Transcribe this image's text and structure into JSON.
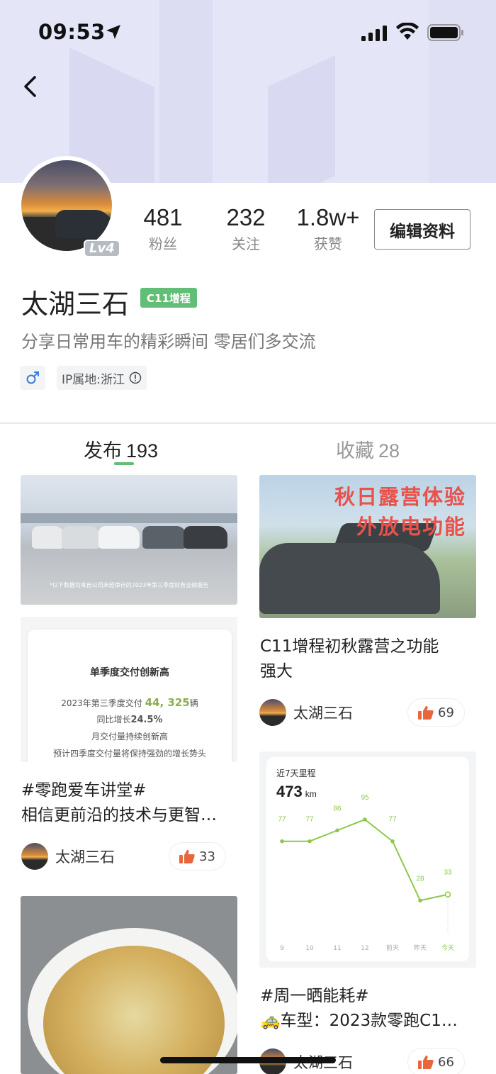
{
  "status_bar": {
    "time": "09:53"
  },
  "profile": {
    "level": "Lv4",
    "stats": [
      {
        "value": "481",
        "label": "粉丝"
      },
      {
        "value": "232",
        "label": "关注"
      },
      {
        "value": "1.8w+",
        "label": "获赞"
      }
    ],
    "edit_label": "编辑资料",
    "name": "太湖三石",
    "car_badge": "C11增程",
    "bio": "分享日常用车的精彩瞬间 零居们多交流",
    "gender_icon": "male-icon",
    "ip_location": "IP属地:浙江"
  },
  "tabs": [
    {
      "label": "发布",
      "count": "193",
      "active": true
    },
    {
      "label": "收藏",
      "count": "28",
      "active": false
    }
  ],
  "feed": {
    "left": [
      {
        "report_image": {
          "footnote": "*以下数据均来自公司未经审计的2023年第三季度财务业绩报告",
          "heading": "单季度交付创新高",
          "line1_prefix": "2023年第三季度交付 ",
          "line1_value": "44, 325",
          "line1_suffix": "辆",
          "line2_prefix": "同比增长",
          "line2_value": "24.5%",
          "line3": "月交付量持续创新高",
          "line4": "预计四季度交付量将保持强劲的增长势头"
        },
        "title_line1": "#零跑爱车讲堂#",
        "title_line2": "相信更前沿的技术与更智…",
        "author": "太湖三石",
        "likes": "33"
      },
      {
        "image": "noodle-bowl"
      }
    ],
    "right": [
      {
        "overlay_line1": "秋日露营体验",
        "overlay_line2": "外放电功能",
        "title_line1": "C11增程初秋露营之功能",
        "title_line2": "强大",
        "author": "太湖三石",
        "likes": "69"
      },
      {
        "chart_caption": "近7天里程",
        "chart_total": "473",
        "chart_unit": "km",
        "title_line1": "#周一晒能耗#",
        "title_line2": "🚕车型：2023款零跑C1…",
        "author": "太湖三石",
        "likes": "66"
      }
    ]
  },
  "colors": {
    "accent": "#62bd76",
    "like": "#e8663d",
    "chart_line": "#8cc84b"
  },
  "chart_data": {
    "type": "line",
    "title": "近7天里程",
    "total": "473 km",
    "categories": [
      "9",
      "10",
      "11",
      "12",
      "前天",
      "昨天",
      "今天"
    ],
    "values": [
      77,
      77,
      86,
      95,
      77,
      28,
      33
    ],
    "grid": false
  }
}
